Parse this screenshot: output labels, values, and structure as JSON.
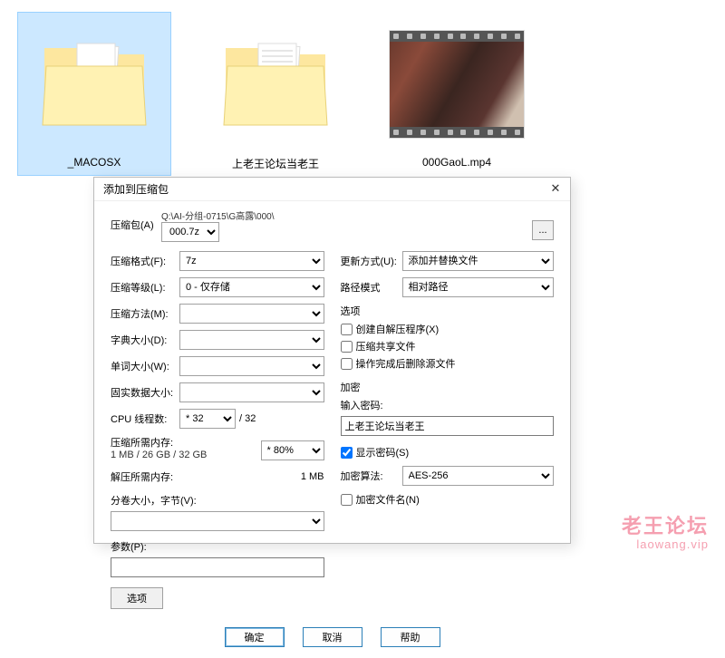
{
  "desktop": {
    "items": [
      {
        "name": "_MACOSX",
        "type": "folder",
        "selected": true
      },
      {
        "name": "上老王论坛当老王",
        "type": "folder",
        "selected": false
      },
      {
        "name": "000GaoL.mp4",
        "type": "video",
        "selected": false
      }
    ]
  },
  "dialog": {
    "title": "添加到压缩包",
    "archive_label": "压缩包(A)",
    "archive_path": "Q:\\AI-分组-0715\\G高露\\000\\",
    "archive_name": "000.7z",
    "browse": "...",
    "left": {
      "format_label": "压缩格式(F):",
      "format_value": "7z",
      "level_label": "压缩等级(L):",
      "level_value": "0 - 仅存储",
      "method_label": "压缩方法(M):",
      "method_value": "",
      "dict_label": "字典大小(D):",
      "dict_value": "",
      "word_label": "单词大小(W):",
      "word_value": "",
      "solid_label": "固实数据大小:",
      "solid_value": "",
      "cpu_label": "CPU 线程数:",
      "cpu_value": "* 32",
      "cpu_total": "/ 32",
      "mem_compress_label": "压缩所需内存:",
      "mem_compress_value": "1 MB / 26 GB / 32 GB",
      "mem_compress_right_label": "",
      "mem_compress_right_value": "* 80%",
      "mem_decompress_label": "解压所需内存:",
      "mem_decompress_value": "1 MB",
      "split_label": "分卷大小，字节(V):",
      "split_value": "",
      "params_label": "参数(P):",
      "params_value": "",
      "options_btn": "选项"
    },
    "right": {
      "update_label": "更新方式(U):",
      "update_value": "添加并替换文件",
      "path_label": "路径模式",
      "path_value": "相对路径",
      "options_group": "选项",
      "opt_sfx": "创建自解压程序(X)",
      "opt_share": "压缩共享文件",
      "opt_delete": "操作完成后删除源文件",
      "encrypt_group": "加密",
      "pwd_label": "输入密码:",
      "pwd_value": "上老王论坛当老王",
      "show_pwd": "显示密码(S)",
      "algo_label": "加密算法:",
      "algo_value": "AES-256",
      "encrypt_names": "加密文件名(N)"
    },
    "buttons": {
      "ok": "确定",
      "cancel": "取消",
      "help": "帮助"
    }
  },
  "watermark": {
    "line1": "老王论坛",
    "line2": "laowang.vip"
  }
}
